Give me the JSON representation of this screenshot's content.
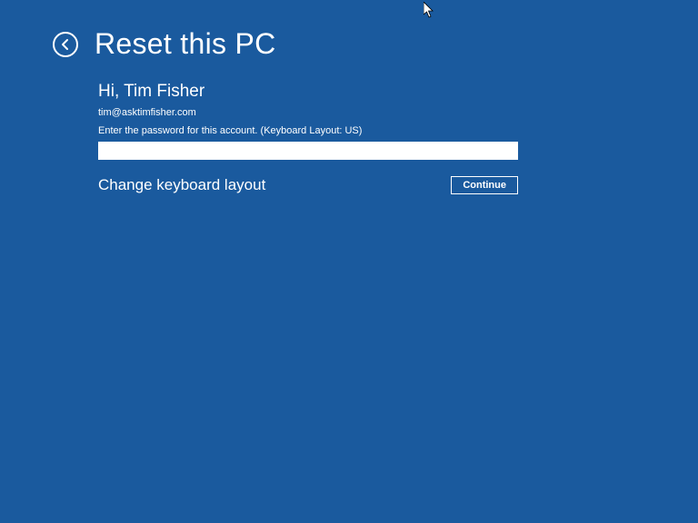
{
  "header": {
    "title": "Reset this PC"
  },
  "content": {
    "greeting": "Hi, Tim Fisher",
    "email": "tim@asktimfisher.com",
    "prompt": "Enter the password for this account. (Keyboard Layout: US)",
    "password_value": ""
  },
  "footer": {
    "change_layout_label": "Change keyboard layout",
    "continue_label": "Continue"
  }
}
